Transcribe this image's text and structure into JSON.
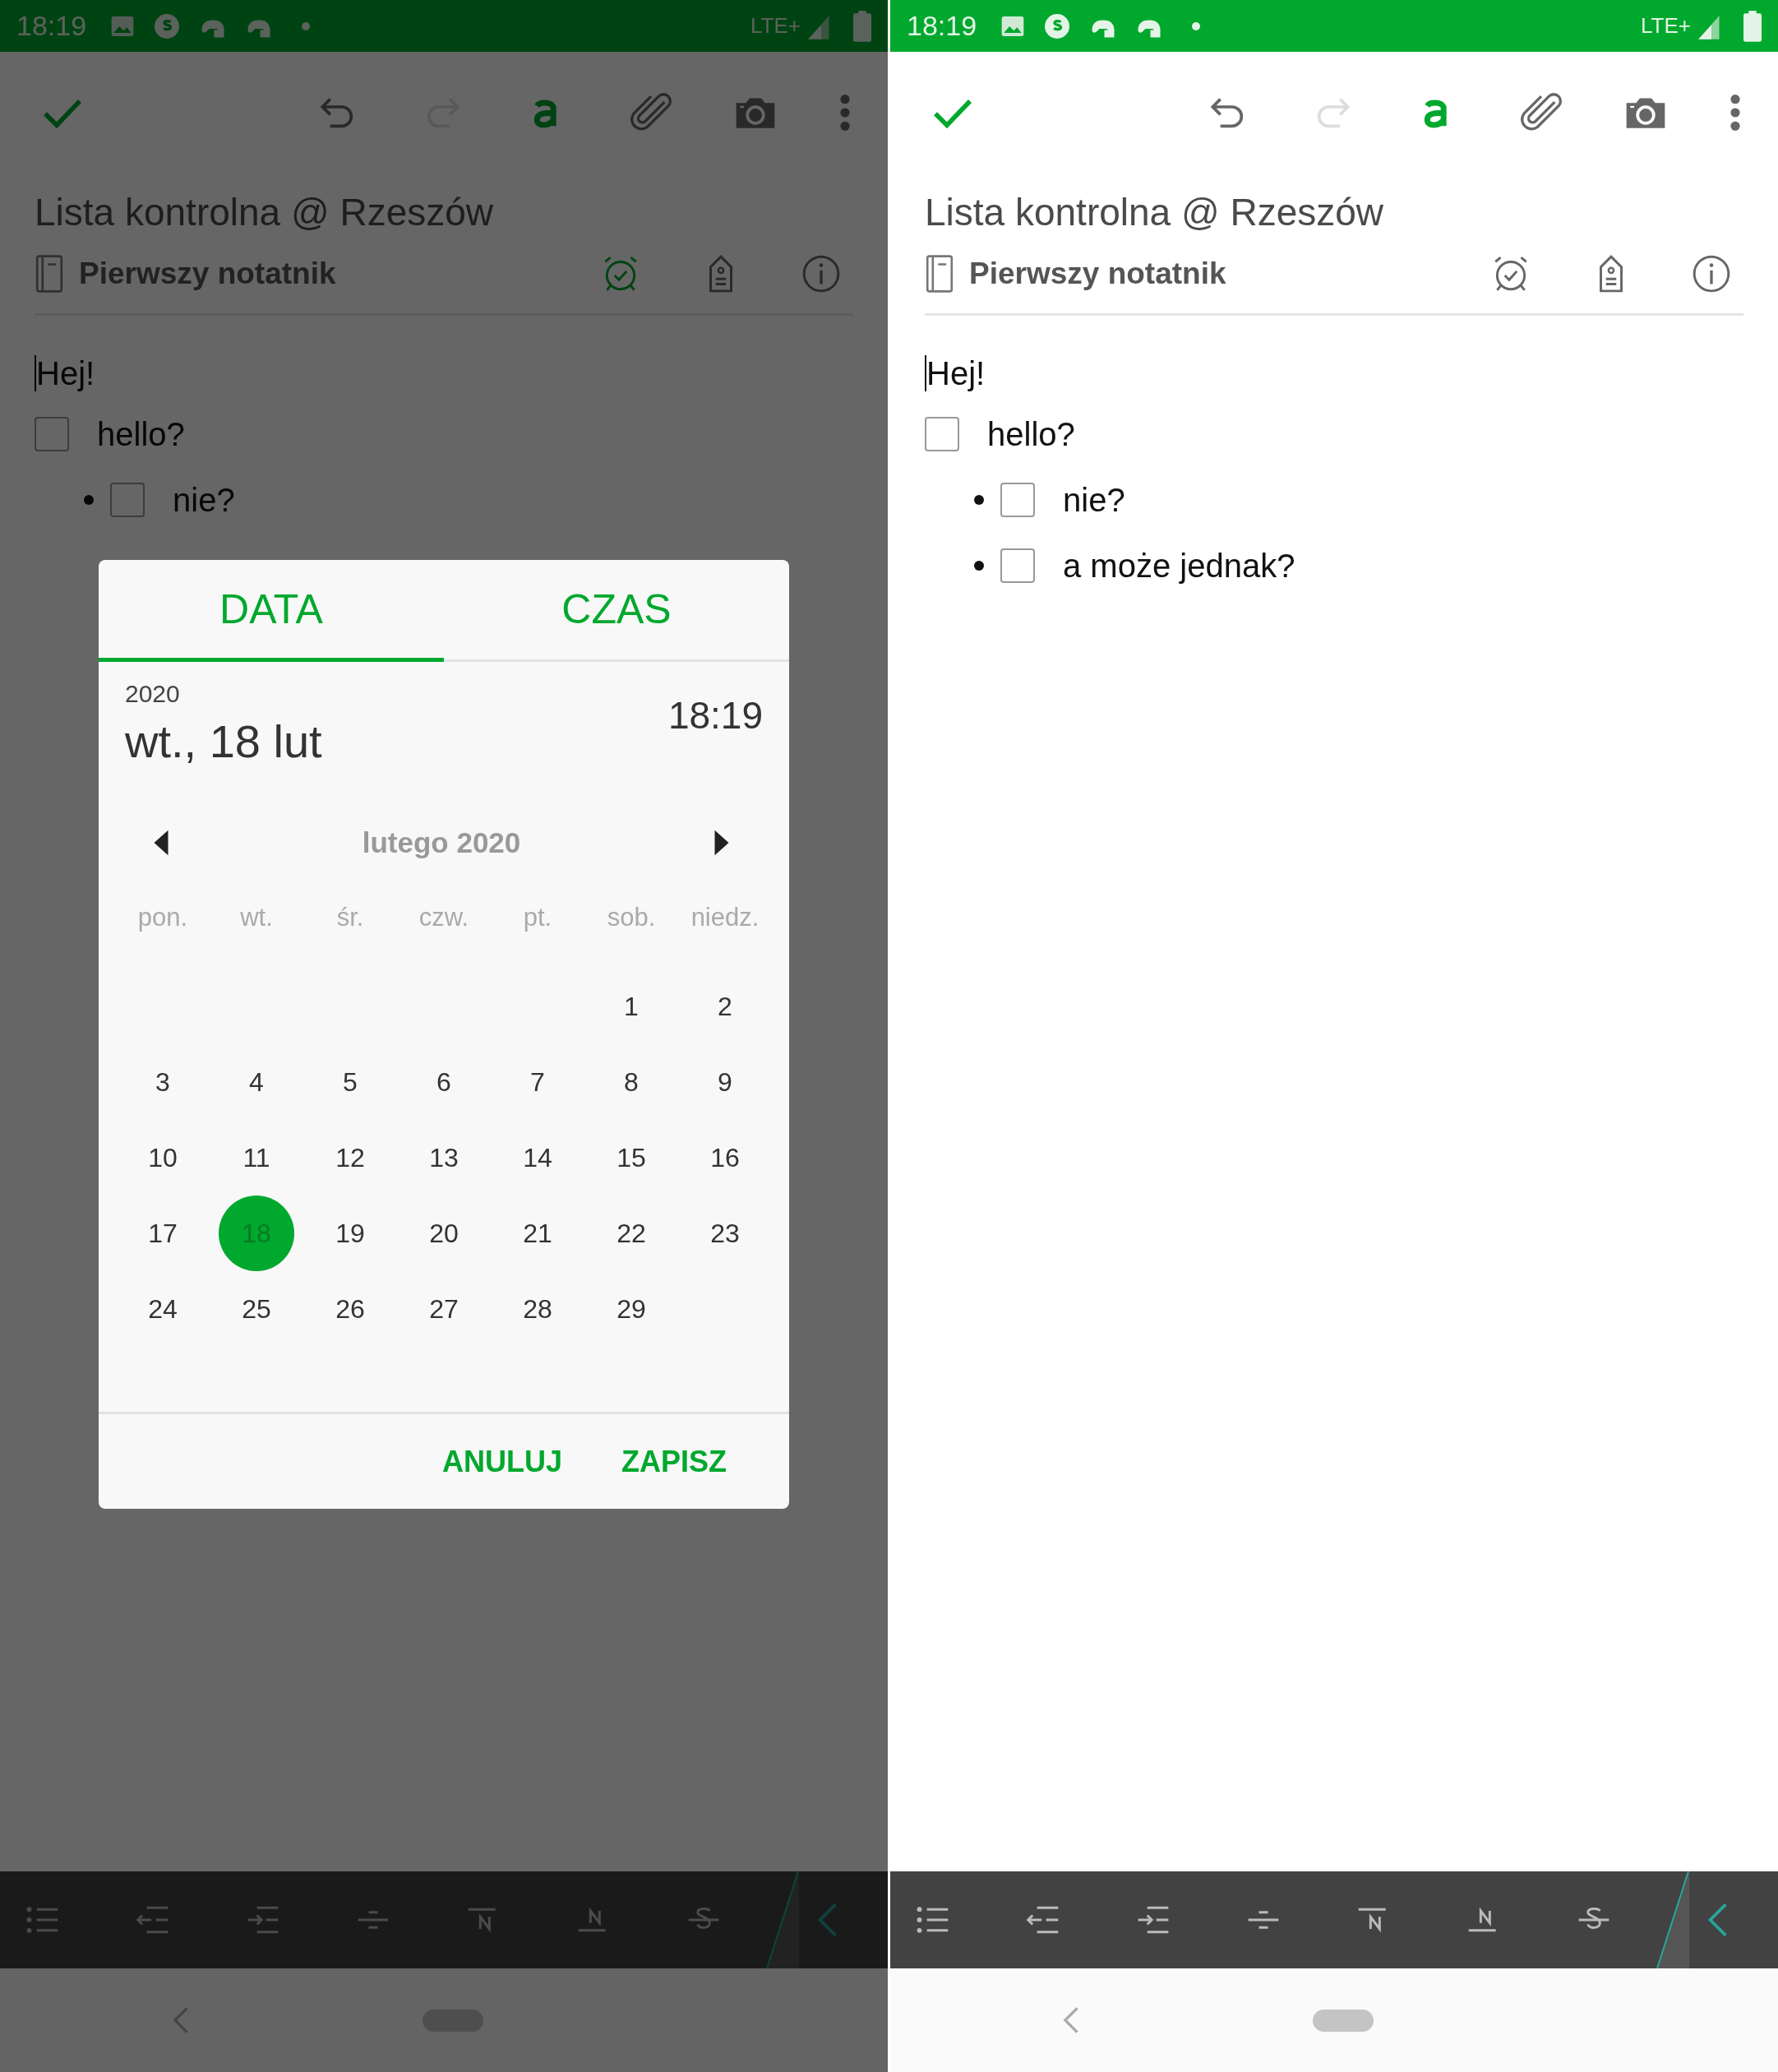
{
  "screens": [
    {
      "dimmed": true,
      "status_bar": {
        "time": "18:19",
        "network": "LTE+"
      },
      "toolbar": {
        "undo_disabled": false,
        "redo_disabled": true
      },
      "note": {
        "title": "Lista kontrolna @ Rzeszów",
        "notebook": "Pierwszy notatnik",
        "reminder_set": true,
        "body": [
          {
            "kind": "text",
            "text": "Hej!"
          },
          {
            "kind": "checkbox",
            "text": "hello?",
            "checked": false,
            "children": [
              {
                "kind": "checkbox",
                "text": "nie?",
                "checked": false
              }
            ]
          }
        ]
      },
      "dialog": {
        "tabs": [
          {
            "label": "DATA",
            "selected": true
          },
          {
            "label": "CZAS",
            "selected": false
          }
        ],
        "year": "2020",
        "date": "wt., 18 lut",
        "time": "18:19",
        "month": "lutego 2020",
        "weekdays": [
          "pon.",
          "wt.",
          "śr.",
          "czw.",
          "pt.",
          "sob.",
          "niedz."
        ],
        "weeks": [
          [
            {
              "kind": "blank"
            },
            {
              "kind": "blank"
            },
            {
              "kind": "blank"
            },
            {
              "kind": "blank"
            },
            {
              "kind": "blank"
            },
            {
              "kind": "day",
              "day": "1",
              "selected": false
            },
            {
              "kind": "day",
              "day": "2",
              "selected": false
            }
          ],
          [
            {
              "kind": "day",
              "day": "3",
              "selected": false
            },
            {
              "kind": "day",
              "day": "4",
              "selected": false
            },
            {
              "kind": "day",
              "day": "5",
              "selected": false
            },
            {
              "kind": "day",
              "day": "6",
              "selected": false
            },
            {
              "kind": "day",
              "day": "7",
              "selected": false
            },
            {
              "kind": "day",
              "day": "8",
              "selected": false
            },
            {
              "kind": "day",
              "day": "9",
              "selected": false
            }
          ],
          [
            {
              "kind": "day",
              "day": "10",
              "selected": false
            },
            {
              "kind": "day",
              "day": "11",
              "selected": false
            },
            {
              "kind": "day",
              "day": "12",
              "selected": false
            },
            {
              "kind": "day",
              "day": "13",
              "selected": false
            },
            {
              "kind": "day",
              "day": "14",
              "selected": false
            },
            {
              "kind": "day",
              "day": "15",
              "selected": false
            },
            {
              "kind": "day",
              "day": "16",
              "selected": false
            }
          ],
          [
            {
              "kind": "day",
              "day": "17",
              "selected": false
            },
            {
              "kind": "day",
              "day": "18",
              "selected": true
            },
            {
              "kind": "day",
              "day": "19",
              "selected": false
            },
            {
              "kind": "day",
              "day": "20",
              "selected": false
            },
            {
              "kind": "day",
              "day": "21",
              "selected": false
            },
            {
              "kind": "day",
              "day": "22",
              "selected": false
            },
            {
              "kind": "day",
              "day": "23",
              "selected": false
            }
          ],
          [
            {
              "kind": "day",
              "day": "24",
              "selected": false
            },
            {
              "kind": "day",
              "day": "25",
              "selected": false
            },
            {
              "kind": "day",
              "day": "26",
              "selected": false
            },
            {
              "kind": "day",
              "day": "27",
              "selected": false
            },
            {
              "kind": "day",
              "day": "28",
              "selected": false
            },
            {
              "kind": "day",
              "day": "29",
              "selected": false
            },
            {
              "kind": "blank"
            }
          ]
        ],
        "buttons": [
          "ANULUJ",
          "ZAPISZ"
        ]
      }
    },
    {
      "dimmed": false,
      "status_bar": {
        "time": "18:19",
        "network": "LTE+"
      },
      "toolbar": {
        "undo_disabled": false,
        "redo_disabled": true
      },
      "note": {
        "title": "Lista kontrolna @ Rzeszów",
        "notebook": "Pierwszy notatnik",
        "reminder_set": false,
        "body": [
          {
            "kind": "text",
            "text": "Hej!"
          },
          {
            "kind": "checkbox",
            "text": "hello?",
            "checked": false,
            "children": [
              {
                "kind": "checkbox",
                "text": "nie?",
                "checked": false
              },
              {
                "kind": "checkbox",
                "text": "a może jednak?",
                "checked": false
              }
            ]
          }
        ]
      }
    }
  ]
}
